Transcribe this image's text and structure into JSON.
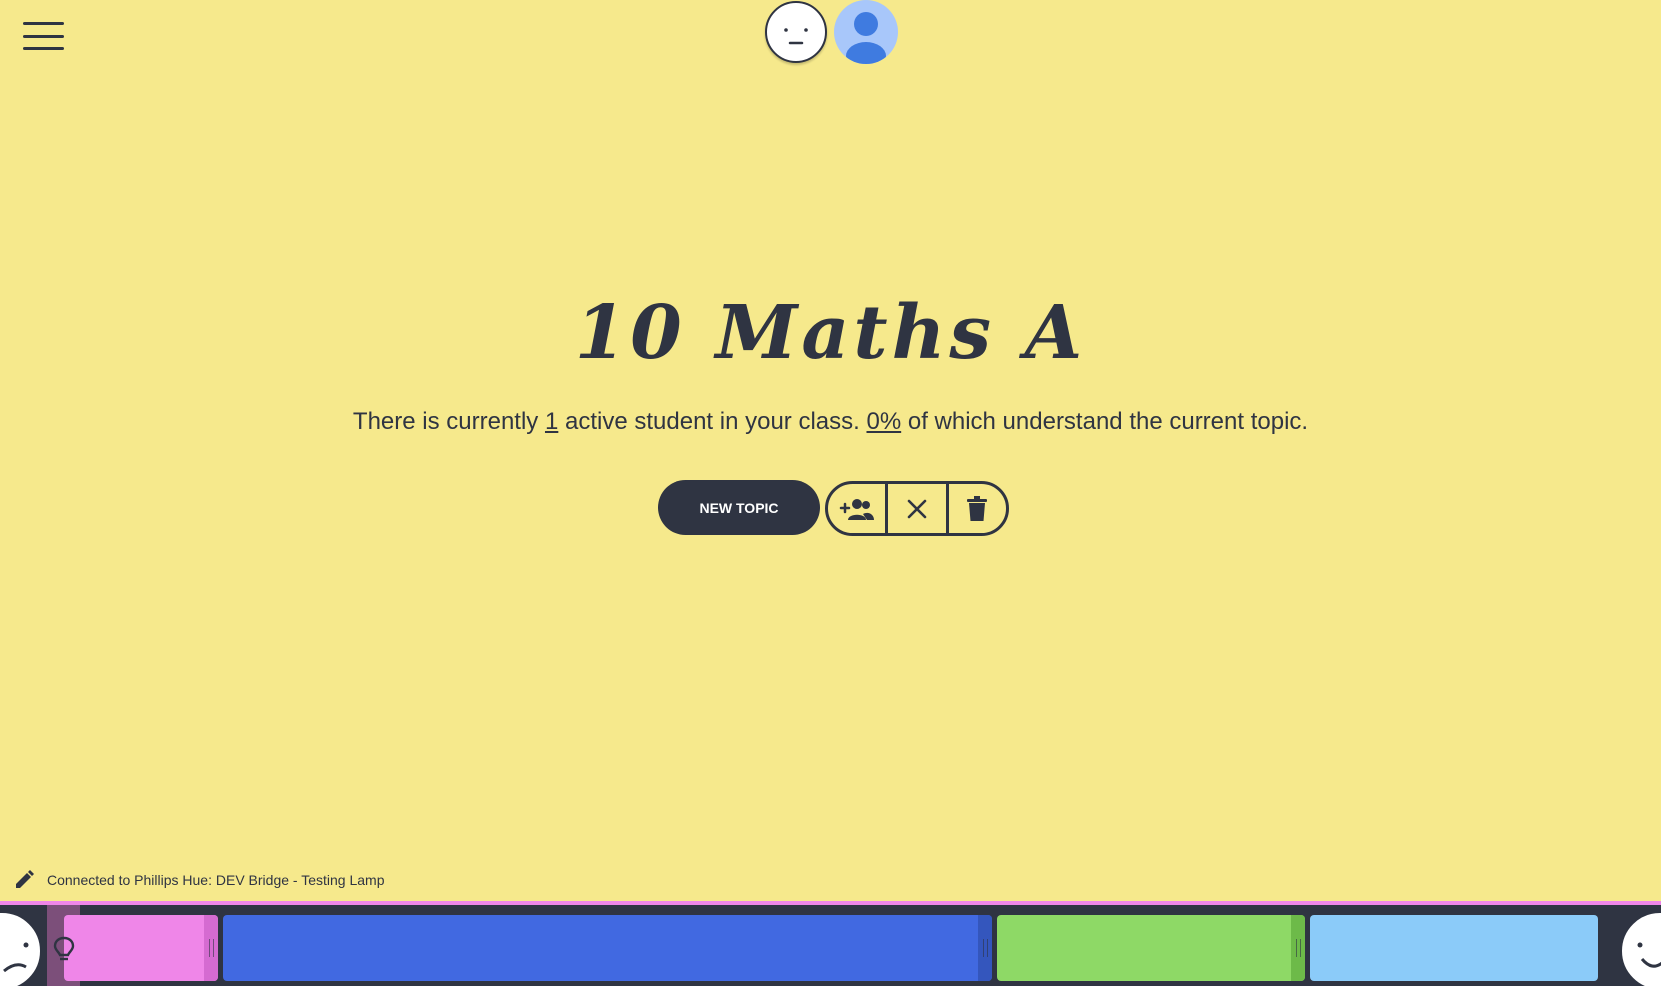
{
  "header": {
    "menu_icon": "hamburger-menu-icon",
    "mood_avatar_icon": "neutral-face-icon",
    "user_avatar_icon": "user-avatar-icon"
  },
  "main": {
    "class_title": "10 Maths A",
    "status": {
      "prefix": "There is currently ",
      "active_count": "1",
      "middle": " active student in your class. ",
      "understanding_percent": "0%",
      "suffix": " of which understand the current topic."
    },
    "new_topic_label": "NEW TOPIC",
    "actions": {
      "add_students_icon": "add-group-icon",
      "close_icon": "close-icon",
      "delete_icon": "trash-icon"
    }
  },
  "footer": {
    "edit_icon": "pencil-icon",
    "connection_text": "Connected to Phillips Hue: DEV Bridge - Testing Lamp"
  },
  "colors": {
    "background": "#f6e98c",
    "dark": "#2f3442",
    "pink": "#ef86e8",
    "blue": "#4169e1",
    "green": "#8ed966",
    "light_blue": "#8bcbf9"
  }
}
